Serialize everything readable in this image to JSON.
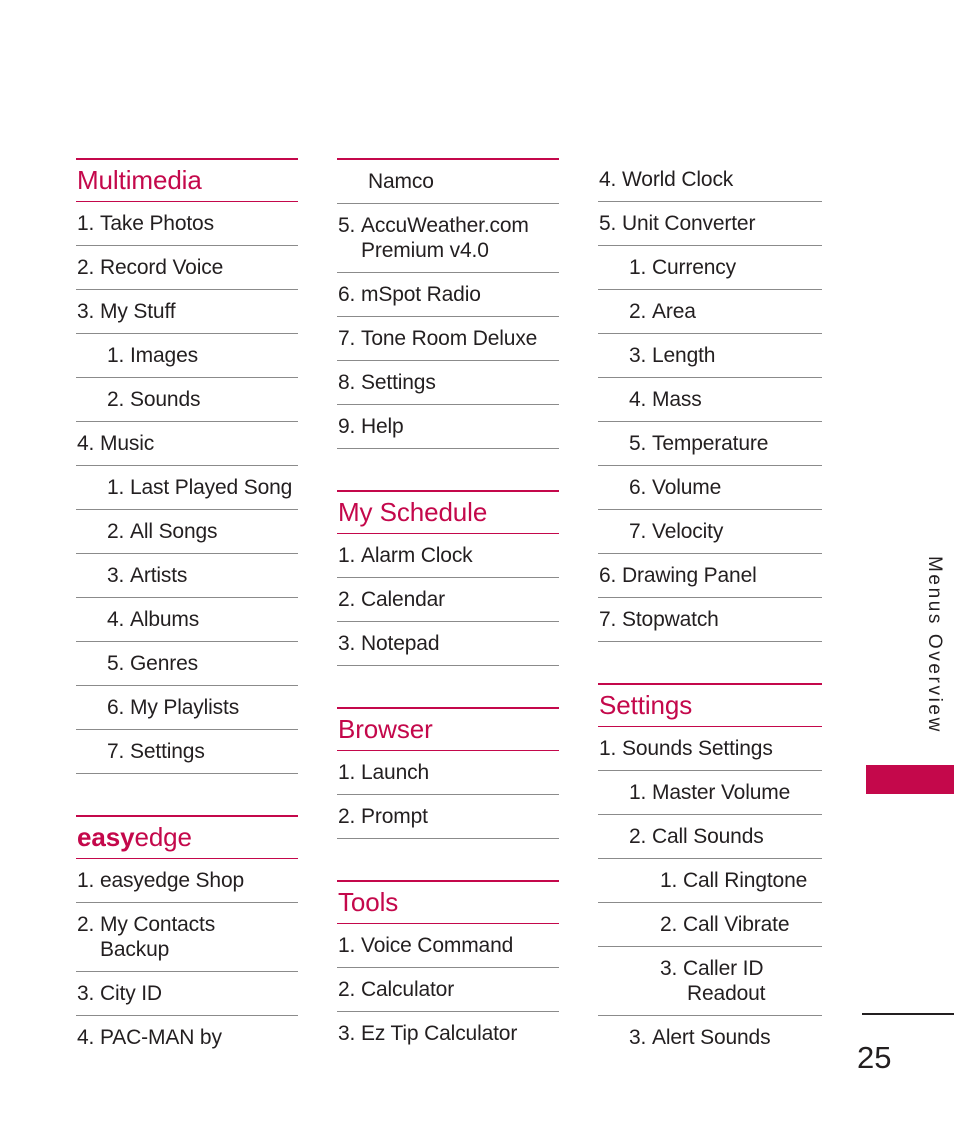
{
  "page": {
    "number": "25",
    "side_tab_label": "Menus Overview",
    "accent_color": "#c4084b",
    "rule_color": "#8b8b8b",
    "text_color": "#231f20"
  },
  "columns": [
    {
      "name": "column-1",
      "sections": [
        {
          "id": "multimedia",
          "title": "Multimedia",
          "title_bold_prefix": "",
          "has_title": true,
          "spaced": false,
          "items": [
            {
              "level": 1,
              "num": "1.",
              "label": "Take Photos"
            },
            {
              "level": 1,
              "num": "2.",
              "label": "Record Voice"
            },
            {
              "level": 1,
              "num": "3.",
              "label": "My Stuff"
            },
            {
              "level": 2,
              "num": "1.",
              "label": "Images"
            },
            {
              "level": 2,
              "num": "2.",
              "label": "Sounds"
            },
            {
              "level": 1,
              "num": "4.",
              "label": "Music"
            },
            {
              "level": 2,
              "num": "1.",
              "label": "Last Played Song"
            },
            {
              "level": 2,
              "num": "2.",
              "label": "All Songs"
            },
            {
              "level": 2,
              "num": "3.",
              "label": "Artists"
            },
            {
              "level": 2,
              "num": "4.",
              "label": "Albums"
            },
            {
              "level": 2,
              "num": "5.",
              "label": "Genres"
            },
            {
              "level": 2,
              "num": "6.",
              "label": "My Playlists"
            },
            {
              "level": 2,
              "num": "7.",
              "label": "Settings"
            }
          ]
        },
        {
          "id": "easyedge",
          "title": "easyedge",
          "title_bold_prefix": "easy",
          "title_rest": "edge",
          "has_title": true,
          "spaced": true,
          "items": [
            {
              "level": 1,
              "num": "1.",
              "label": "easyedge Shop"
            },
            {
              "level": 1,
              "num": "2.",
              "label": "My Contacts",
              "label2": "Backup"
            },
            {
              "level": 1,
              "num": "3.",
              "label": "City ID"
            },
            {
              "level": 1,
              "num": "4.",
              "label": "PAC-MAN by",
              "last_no_line": true
            }
          ]
        }
      ]
    },
    {
      "name": "column-2",
      "sections": [
        {
          "id": "easyedge-continued",
          "title": "",
          "has_title": false,
          "spaced": false,
          "pink_top": true,
          "items": [
            {
              "level": 2,
              "num": "",
              "label": "Namco"
            },
            {
              "level": 1,
              "num": "5.",
              "label": "AccuWeather.com",
              "label2": "Premium v4.0"
            },
            {
              "level": 1,
              "num": "6.",
              "label": "mSpot Radio"
            },
            {
              "level": 1,
              "num": "7.",
              "label": "Tone Room Deluxe"
            },
            {
              "level": 1,
              "num": "8.",
              "label": "Settings"
            },
            {
              "level": 1,
              "num": "9.",
              "label": "Help"
            }
          ]
        },
        {
          "id": "my-schedule",
          "title": "My Schedule",
          "has_title": true,
          "spaced": true,
          "items": [
            {
              "level": 1,
              "num": "1.",
              "label": "Alarm Clock"
            },
            {
              "level": 1,
              "num": "2.",
              "label": "Calendar"
            },
            {
              "level": 1,
              "num": "3.",
              "label": "Notepad"
            }
          ]
        },
        {
          "id": "browser",
          "title": "Browser",
          "has_title": true,
          "spaced": true,
          "items": [
            {
              "level": 1,
              "num": "1.",
              "label": "Launch"
            },
            {
              "level": 1,
              "num": "2.",
              "label": "Prompt"
            }
          ]
        },
        {
          "id": "tools",
          "title": "Tools",
          "has_title": true,
          "spaced": true,
          "items": [
            {
              "level": 1,
              "num": "1.",
              "label": "Voice Command"
            },
            {
              "level": 1,
              "num": "2.",
              "label": "Calculator"
            },
            {
              "level": 1,
              "num": "3.",
              "label": "Ez Tip Calculator",
              "last_no_line": true
            }
          ]
        }
      ]
    },
    {
      "name": "column-3",
      "sections": [
        {
          "id": "tools-continued",
          "title": "",
          "has_title": false,
          "spaced": false,
          "pink_top": false,
          "items": [
            {
              "level": 1,
              "num": "4.",
              "label": "World Clock"
            },
            {
              "level": 1,
              "num": "5.",
              "label": "Unit Converter"
            },
            {
              "level": 2,
              "num": "1.",
              "label": "Currency"
            },
            {
              "level": 2,
              "num": "2.",
              "label": "Area"
            },
            {
              "level": 2,
              "num": "3.",
              "label": "Length"
            },
            {
              "level": 2,
              "num": "4.",
              "label": "Mass"
            },
            {
              "level": 2,
              "num": "5.",
              "label": "Temperature"
            },
            {
              "level": 2,
              "num": "6.",
              "label": "Volume"
            },
            {
              "level": 2,
              "num": "7.",
              "label": "Velocity"
            },
            {
              "level": 1,
              "num": "6.",
              "label": "Drawing Panel"
            },
            {
              "level": 1,
              "num": "7.",
              "label": "Stopwatch"
            }
          ]
        },
        {
          "id": "settings",
          "title": "Settings",
          "has_title": true,
          "spaced": true,
          "items": [
            {
              "level": 1,
              "num": "1.",
              "label": "Sounds Settings"
            },
            {
              "level": 2,
              "num": "1.",
              "label": "Master Volume"
            },
            {
              "level": 2,
              "num": "2.",
              "label": "Call Sounds"
            },
            {
              "level": 3,
              "num": "1.",
              "label": "Call Ringtone"
            },
            {
              "level": 3,
              "num": "2.",
              "label": "Call Vibrate"
            },
            {
              "level": 3,
              "num": "3.",
              "label": "Caller ID",
              "label2": "Readout"
            },
            {
              "level": 2,
              "num": "3.",
              "label": "Alert Sounds",
              "last_no_line": true
            }
          ]
        }
      ]
    }
  ]
}
